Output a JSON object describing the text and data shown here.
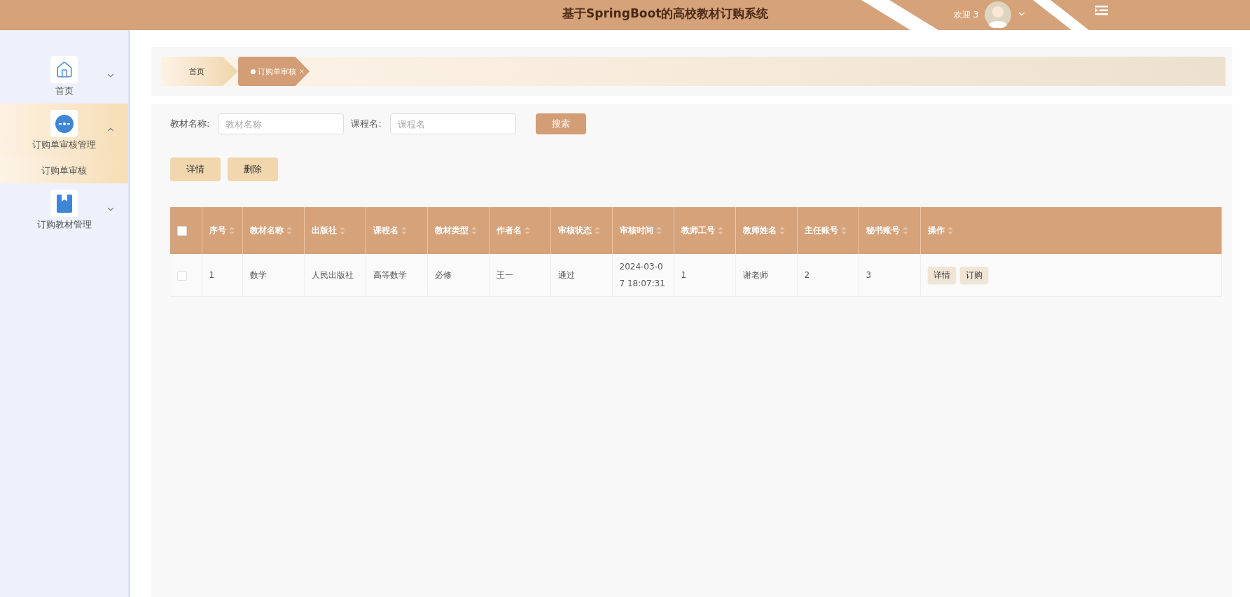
{
  "header": {
    "title": "基于SpringBoot的高校教材订购系统",
    "welcome": "欢迎 3"
  },
  "sidebar": {
    "items": [
      {
        "label": "首页",
        "expanded": false,
        "selected": false
      },
      {
        "label": "订购单审核管理",
        "expanded": true,
        "selected": true,
        "children": [
          {
            "label": "订购单审核",
            "selected": true
          }
        ]
      },
      {
        "label": "订购教材管理",
        "expanded": false,
        "selected": false
      }
    ]
  },
  "breadcrumb": [
    {
      "label": "首页",
      "selected": false
    },
    {
      "label": "订购单审核",
      "selected": true
    }
  ],
  "search": {
    "fields": [
      {
        "label": "教材名称:",
        "placeholder": "教材名称"
      },
      {
        "label": "课程名:",
        "placeholder": "课程名"
      }
    ],
    "button": "搜索"
  },
  "actions": [
    "详情",
    "删除"
  ],
  "table": {
    "select_all": false,
    "columns": [
      "序号",
      "教材名称",
      "出版社",
      "课程名",
      "教材类型",
      "作者名",
      "审核状态",
      "审核时间",
      "教师工号",
      "教师姓名",
      "主任账号",
      "秘书账号",
      "操作"
    ],
    "rows": [
      {
        "checked": false,
        "cells": [
          "1",
          "数学",
          "人民出版社",
          "高等数学",
          "必修",
          "王一",
          "通过",
          "2024-03-07 18:07:31",
          "1",
          "谢老师",
          "2",
          "3"
        ],
        "actions": [
          "详情",
          "订购"
        ]
      }
    ]
  }
}
